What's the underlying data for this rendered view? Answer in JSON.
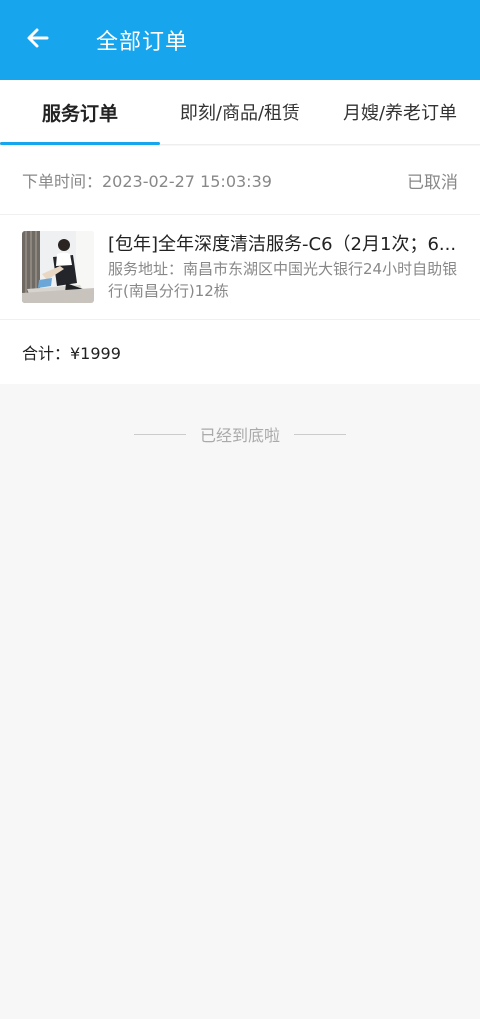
{
  "header": {
    "title": "全部订单",
    "back_icon": "back-arrow-icon"
  },
  "tabs": [
    {
      "label": "服务订单"
    },
    {
      "label": "即刻/商品/租赁"
    },
    {
      "label": "月嫂/养老订单"
    }
  ],
  "order": {
    "time_label": "下单时间：2023-02-27 15:03:39",
    "status": "已取消",
    "item": {
      "title": "[包年]全年深度清洁服务-C6（2月1次；6...",
      "address": "服务地址：南昌市东湖区中国光大银行24小时自助银行(南昌分行)12栋"
    },
    "total": "合计：¥1999"
  },
  "footer": {
    "tip": "已经到底啦"
  },
  "colors": {
    "accent": "#17a6ee",
    "background": "#f7f7f7",
    "card": "#ffffff"
  }
}
